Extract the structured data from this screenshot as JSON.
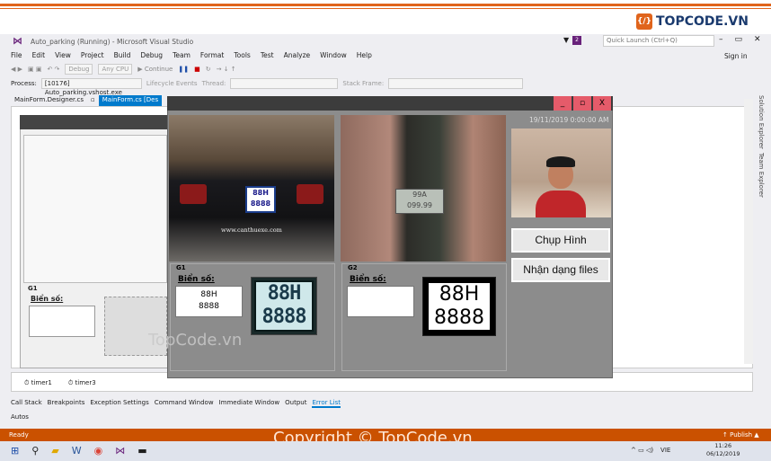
{
  "brand": {
    "logo_text": "TOPCODE.VN"
  },
  "vs": {
    "title": "Auto_parking (Running) - Microsoft Visual Studio",
    "quick_launch": "Quick Launch (Ctrl+Q)",
    "notif_count": "2",
    "sign_in": "Sign in",
    "menu": [
      "File",
      "Edit",
      "View",
      "Project",
      "Build",
      "Debug",
      "Team",
      "Format",
      "Tools",
      "Test",
      "Analyze",
      "Window",
      "Help"
    ],
    "toolbar": {
      "config": "Debug",
      "platform": "Any CPU",
      "continue": "Continue",
      "lifecycle": "Lifecycle Events",
      "thread": "Thread:",
      "stack": "Stack Frame:"
    },
    "process_label": "Process:",
    "process_value": "[10176] Auto_parking.vshost.exe",
    "tabs": [
      {
        "label": "MainForm.Designer.cs"
      },
      {
        "label": "MainForm.cs [Des"
      }
    ],
    "side_tabs": [
      "Solution Explorer",
      "Team Explorer"
    ],
    "timers": [
      "timer1",
      "timer3"
    ],
    "bottom_tabs": [
      "Call Stack",
      "Breakpoints",
      "Exception Settings",
      "Command Window",
      "Immediate Window",
      "Output",
      "Error List"
    ],
    "autos": "Autos",
    "status_left": "Ready",
    "status_right": "↑ Publish ▲",
    "colors": {
      "accent": "#007acc",
      "status": "#ca5100"
    }
  },
  "designer": {
    "g1": "G1",
    "bien_so": "Biển số:"
  },
  "app": {
    "win_buttons": [
      "_",
      "▫",
      "X"
    ],
    "datetime": "19/11/2019 0:00:00 AM",
    "plate_text_image1": [
      "88H",
      "8888"
    ],
    "plate_text_image2": [
      "99A",
      "099.99"
    ],
    "image_watermark": "www.canthuexe.com",
    "btn_capture": "Chụp Hình",
    "btn_recognize": "Nhận dạng files",
    "g1": {
      "title": "G1",
      "label": "Biển số:",
      "line1": "88H",
      "line2": "8888",
      "crop_line1": "88H",
      "crop_line2": "8888"
    },
    "g2": {
      "title": "G2",
      "label": "Biển số:",
      "bw_line1": "88H",
      "bw_line2": "8888"
    }
  },
  "watermarks": {
    "middle": "TopCode.vn",
    "bottom": "Copyright © TopCode.vn"
  },
  "taskbar": {
    "tray": "VIE",
    "time": "11:26",
    "date": "06/12/2019"
  }
}
